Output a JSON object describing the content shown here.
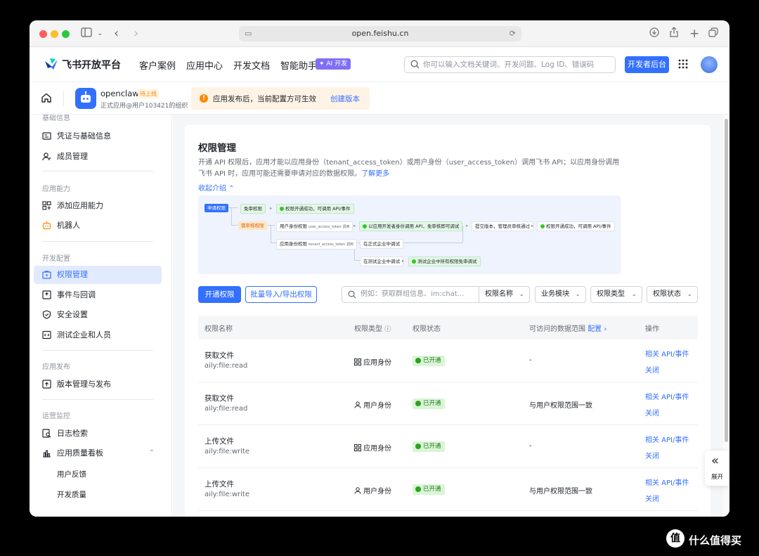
{
  "browser": {
    "url": "open.feishu.cn"
  },
  "topnav": {
    "brand": "飞书开放平台",
    "links": [
      "客户案例",
      "应用中心",
      "开发文档",
      "智能助手"
    ],
    "ai_tag": "✦ AI 开发",
    "search_placeholder": "你可以输入文档关键词、开发问题、Log ID、错误码",
    "dev_button": "开发者后台"
  },
  "app": {
    "name": "openclaw",
    "status_tag": "待上线",
    "subtitle": "正式应用@用户103421的组织",
    "notice_text": "应用发布后，当前配置方可生效",
    "notice_link": "创建版本"
  },
  "sidebar": {
    "groups": {
      "basic": "基础信息",
      "ability": "应用能力",
      "dev": "开发配置",
      "publish": "应用发布",
      "ops": "运营监控"
    },
    "items": {
      "credentials": "凭证与基础信息",
      "members": "成员管理",
      "add_ability": "添加应用能力",
      "bot": "机器人",
      "permissions": "权限管理",
      "events": "事件与回调",
      "security": "安全设置",
      "test": "测试企业和人员",
      "versions": "版本管理与发布",
      "logs": "日志检索",
      "quality": "应用质量看板",
      "feedback": "用户反馈",
      "dev_quality": "开发质量"
    }
  },
  "main": {
    "title": "权限管理",
    "desc": "开通 API 权限后，应用才能以应用身份（tenant_access_token）或用户身份（user_access_token）调用飞书 API；以应用身份调用飞书 API 时，应用可能还需要申请对应的数据权限。",
    "learn_more": "了解更多",
    "collapse": "收起介绍 ⌃",
    "flow": {
      "apply": "申请权限",
      "no_review": "免审权限",
      "no_review_result": "权限开通成功，可调用 API/事件",
      "need_review": "需审核权限",
      "user_perm": "用户身份权限",
      "user_perm_token": "user_access_token 调用",
      "user_result": "以应用开发者身份调用 API，免审核即可调试",
      "submit": "提交版本，管理员审核通过",
      "final_result": "权限开通成功，可调用 API/事件",
      "app_perm": "应用身份权限",
      "app_perm_token": "tenant_access_token 调用",
      "prod_test": "在正式企业中调试",
      "test_test": "在测试企业中调试",
      "test_result": "测试企业中所有权限免审调试"
    },
    "buttons": {
      "open": "开通权限",
      "bulk": "批量导入/导出权限"
    },
    "filters": {
      "search_placeholder": "例如：获取群组信息、im:chat...",
      "name": "权限名称",
      "module": "业务模块",
      "type": "权限类型",
      "status": "权限状态"
    },
    "table": {
      "headers": {
        "name": "权限名称",
        "type": "权限类型",
        "status": "权限状态",
        "range": "可访问的数据范围",
        "config": "配置 ›",
        "ops": "操作"
      },
      "rows": [
        {
          "name": "获取文件",
          "scope": "aily:file:read",
          "type": "应用身份",
          "status": "已开通",
          "range": "-",
          "op1": "相关 API/事件",
          "op2": "关闭"
        },
        {
          "name": "获取文件",
          "scope": "aily:file:read",
          "type": "用户身份",
          "status": "已开通",
          "range": "与用户权限范围一致",
          "op1": "相关 API/事件",
          "op2": "关闭"
        },
        {
          "name": "上传文件",
          "scope": "aily:file:write",
          "type": "应用身份",
          "status": "已开通",
          "range": "-",
          "op1": "相关 API/事件",
          "op2": "关闭"
        },
        {
          "name": "上传文件",
          "scope": "aily:file:write",
          "type": "用户身份",
          "status": "已开通",
          "range": "与用户权限范围一致",
          "op1": "相关 API/事件",
          "op2": "关闭"
        }
      ]
    },
    "expand_label": "展开"
  },
  "watermark": {
    "text": "什么值得买",
    "icon": "值"
  },
  "colors": {
    "accent": "#3370ff",
    "success": "#2ea121",
    "warning": "#ff8800"
  }
}
